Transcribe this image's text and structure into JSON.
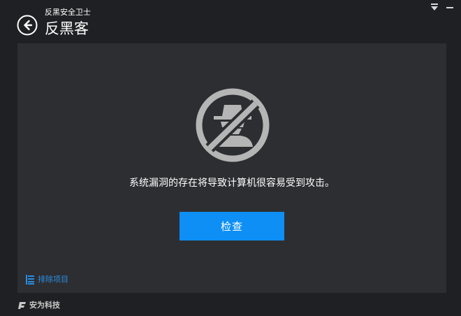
{
  "header": {
    "app_name": "反黑安全卫士",
    "page_title": "反黑客"
  },
  "main": {
    "message": "系统漏洞的存在将导致计算机很容易受到攻击。",
    "check_button_label": "检查",
    "exclude_link_label": "排除项目"
  },
  "footer": {
    "brand": "安为科技"
  },
  "icons": {
    "back": "back-arrow-icon",
    "menu": "dropdown-menu-icon",
    "minimize": "minimize-icon",
    "hacker": "hacker-blocked-icon",
    "exclude": "list-icon",
    "brand": "brand-logo-icon"
  },
  "colors": {
    "window_bg": "#1f2023",
    "panel_bg": "#2d2e32",
    "primary_button": "#0d8ff5",
    "link": "#2a8de0",
    "icon_gray": "#b5b5b5"
  }
}
